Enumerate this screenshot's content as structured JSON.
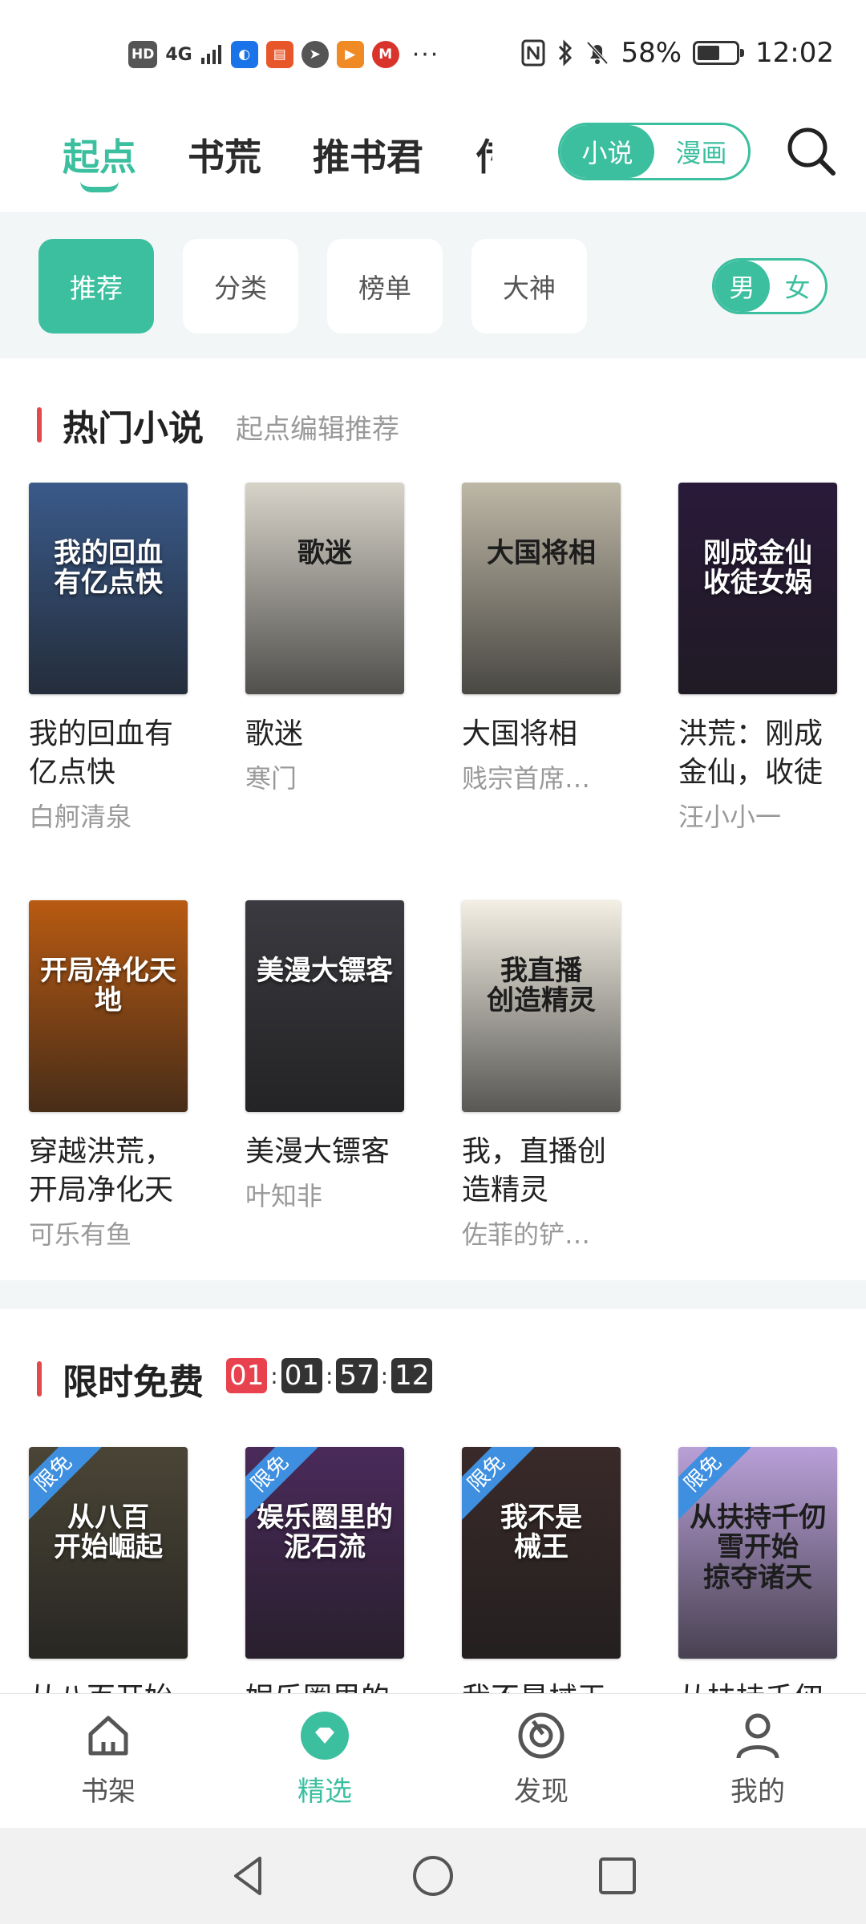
{
  "status_bar": {
    "hd_label": "HD",
    "signal_label": "4G",
    "battery": "58%",
    "battery_level": 0.58,
    "time": "12:02",
    "more_label": "···"
  },
  "top_tabs": [
    {
      "label": "起点",
      "active": true
    },
    {
      "label": "书荒",
      "active": false
    },
    {
      "label": "推书君",
      "active": false
    },
    {
      "label": "传",
      "active": false
    }
  ],
  "type_toggle": {
    "selected": "小说",
    "other": "漫画"
  },
  "filter_chips": [
    {
      "label": "推荐",
      "active": true
    },
    {
      "label": "分类",
      "active": false
    },
    {
      "label": "榜单",
      "active": false
    },
    {
      "label": "大神",
      "active": false
    }
  ],
  "gender_toggle": {
    "selected": "男",
    "other": "女"
  },
  "hot_section": {
    "title": "热门小说",
    "subtitle": "起点编辑推荐",
    "books": [
      {
        "name": "我的回血有亿点快",
        "author": "白舸清泉",
        "cover_text": "我的回血\n有亿点快",
        "cover_color": "#3a5a8a"
      },
      {
        "name": "歌迷",
        "author": "寒门",
        "cover_text": "歌迷",
        "cover_color": "#d7d3c9"
      },
      {
        "name": "大国将相",
        "author": "贱宗首席…",
        "cover_text": "大国将相",
        "cover_color": "#bdb7a6"
      },
      {
        "name": "洪荒：刚成金仙，收徒",
        "author": "汪小小一",
        "cover_text": "刚成金仙\n收徒女娲",
        "cover_color": "#2a1a3a"
      },
      {
        "name": "穿越洪荒，开局净化天",
        "author": "可乐有鱼",
        "cover_text": "开局净化天地",
        "cover_color": "#b85a12"
      },
      {
        "name": "美漫大镖客",
        "author": "叶知非",
        "cover_text": "美漫大镖客",
        "cover_color": "#3a3a40"
      },
      {
        "name": "我，直播创造精灵",
        "author": "佐菲的铲…",
        "cover_text": "我直播\n创造精灵",
        "cover_color": "#f3efe4"
      }
    ]
  },
  "free_section": {
    "title": "限时免费",
    "timer": [
      "01",
      "01",
      "57",
      "12"
    ],
    "badge": "限免",
    "books": [
      {
        "name": "从八百开始崛起",
        "cover_text": "从八百\n开始崛起",
        "cover_color": "#4a4536"
      },
      {
        "name": "娱乐圈里的泥石流",
        "cover_text": "娱乐圈里的\n泥石流",
        "cover_color": "#4a2a5a"
      },
      {
        "name": "我不是械王",
        "cover_text": "我不是\n械王",
        "cover_color": "#3a2a2a"
      },
      {
        "name": "从扶持千仞雪开始掠夺诸天",
        "cover_text": "从扶持千仞雪开始\n掠夺诸天",
        "cover_color": "#b9a0d8"
      }
    ],
    "names_visible": [
      "从八百开始",
      "娱乐圈里的",
      "我不是械王",
      "从扶持千仞"
    ]
  },
  "bottom_nav": [
    {
      "label": "书架",
      "icon": "home-icon",
      "active": false
    },
    {
      "label": "精选",
      "icon": "diamond-icon",
      "active": true
    },
    {
      "label": "发现",
      "icon": "compass-icon",
      "active": false
    },
    {
      "label": "我的",
      "icon": "person-icon",
      "active": false
    }
  ],
  "colors": {
    "accent": "#3cbf9f",
    "section_bar": "#e04a4a",
    "timer_red": "#e8424e",
    "badge_blue": "#3f8fe0"
  }
}
